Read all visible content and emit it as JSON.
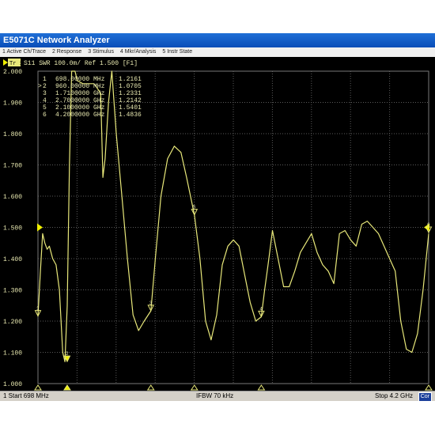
{
  "window": {
    "title": "E5071C Network Analyzer"
  },
  "menu": [
    "1 Active Ch/Trace",
    "2 Response",
    "3 Stimulus",
    "4 Mkr/Analysis",
    "5 Instr State"
  ],
  "trace_header": {
    "badge": "Tr 1",
    "text": "S11  SWR 100.0m/ Ref 1.500 [F1]"
  },
  "markers": [
    {
      "id": "1",
      "active": false,
      "freq": "698.00000 MHz",
      "value": "1.2161"
    },
    {
      "id": "2",
      "active": true,
      "freq": "960.00000 MHz",
      "value": "1.0705"
    },
    {
      "id": "3",
      "active": false,
      "freq": "1.7100000 GHz",
      "value": "1.2331"
    },
    {
      "id": "4",
      "active": false,
      "freq": "2.7000000 GHz",
      "value": "1.2142"
    },
    {
      "id": "5",
      "active": false,
      "freq": "2.1000000 GHz",
      "value": "1.5401"
    },
    {
      "id": "6",
      "active": false,
      "freq": "4.2000000 GHz",
      "value": "1.4836"
    }
  ],
  "status": {
    "start": "1  Start 698 MHz",
    "ifbw": "IFBW 70 kHz",
    "stop": "Stop 4.2 GHz",
    "correction": "Cor"
  },
  "colors": {
    "trace": "#e8e87a",
    "grid": "#5a5a5a",
    "text": "#e8e8b0",
    "ref_marker": "#f0f000"
  },
  "chart_data": {
    "type": "line",
    "title": "",
    "xlabel": "",
    "ylabel": "",
    "ylim": [
      1.0,
      2.0
    ],
    "reference": 1.5,
    "y_ticks": [
      "2.000",
      "1.900",
      "1.800",
      "1.700",
      "1.600",
      "1.500",
      "1.400",
      "1.300",
      "1.200",
      "1.100",
      "1.000"
    ],
    "series": [
      {
        "x": [
          0.698,
          0.72,
          0.74,
          0.76,
          0.78,
          0.8,
          0.83,
          0.86,
          0.89,
          0.92,
          0.94,
          0.96,
          0.98,
          1.0,
          1.02,
          1.03,
          1.05,
          1.1,
          1.2,
          1.26,
          1.28,
          1.3,
          1.33,
          1.36,
          1.4,
          1.45,
          1.5,
          1.55,
          1.6,
          1.65,
          1.71,
          1.75,
          1.8,
          1.86,
          1.92,
          1.98,
          2.03,
          2.1,
          2.15,
          2.2,
          2.25,
          2.3,
          2.35,
          2.4,
          2.45,
          2.5,
          2.55,
          2.6,
          2.65,
          2.7,
          2.73,
          2.76,
          2.8,
          2.85,
          2.9,
          2.95,
          3.0,
          3.05,
          3.1,
          3.15,
          3.2,
          3.25,
          3.3,
          3.35,
          3.4,
          3.45,
          3.5,
          3.55,
          3.6,
          3.65,
          3.7,
          3.75,
          3.8,
          3.85,
          3.9,
          3.95,
          4.0,
          4.05,
          4.1,
          4.15,
          4.2
        ],
        "y": [
          1.216,
          1.36,
          1.48,
          1.45,
          1.43,
          1.44,
          1.4,
          1.38,
          1.3,
          1.1,
          1.07,
          1.25,
          1.7,
          2.1,
          2.1,
          2.05,
          1.97,
          1.96,
          1.96,
          1.93,
          1.66,
          1.72,
          1.9,
          2.1,
          1.8,
          1.6,
          1.4,
          1.22,
          1.17,
          1.2,
          1.233,
          1.4,
          1.6,
          1.72,
          1.76,
          1.74,
          1.66,
          1.54,
          1.4,
          1.2,
          1.14,
          1.22,
          1.38,
          1.44,
          1.46,
          1.44,
          1.35,
          1.26,
          1.2,
          1.214,
          1.3,
          1.38,
          1.49,
          1.4,
          1.31,
          1.31,
          1.36,
          1.42,
          1.45,
          1.48,
          1.42,
          1.38,
          1.36,
          1.32,
          1.48,
          1.49,
          1.46,
          1.44,
          1.51,
          1.52,
          1.5,
          1.48,
          1.44,
          1.4,
          1.36,
          1.2,
          1.11,
          1.1,
          1.16,
          1.3,
          1.48
        ]
      }
    ]
  }
}
